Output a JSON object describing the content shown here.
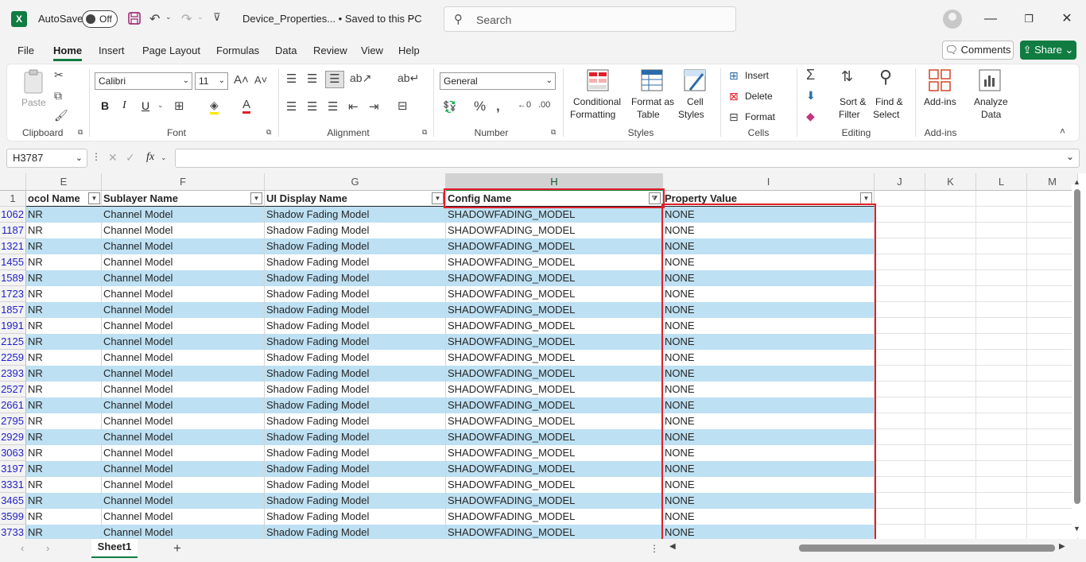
{
  "titlebar": {
    "autosave_label": "AutoSave",
    "autosave_state": "Off",
    "doc_title": "Device_Properties...  •  Saved to this PC",
    "search_placeholder": "Search"
  },
  "menu": {
    "items": [
      "File",
      "Home",
      "Insert",
      "Page Layout",
      "Formulas",
      "Data",
      "Review",
      "View",
      "Help"
    ],
    "active": "Home",
    "comments_label": "Comments",
    "share_label": "Share"
  },
  "ribbon": {
    "clipboard": {
      "label": "Clipboard",
      "paste": "Paste"
    },
    "font": {
      "label": "Font",
      "name": "Calibri",
      "size": "11"
    },
    "alignment": {
      "label": "Alignment"
    },
    "number": {
      "label": "Number",
      "format": "General"
    },
    "styles": {
      "label": "Styles",
      "conditional_1": "Conditional",
      "conditional_2": "Formatting",
      "format_table_1": "Format as",
      "format_table_2": "Table",
      "cell_styles_1": "Cell",
      "cell_styles_2": "Styles"
    },
    "cells": {
      "label": "Cells",
      "insert": "Insert",
      "delete": "Delete",
      "format": "Format"
    },
    "editing": {
      "label": "Editing",
      "sort_1": "Sort &",
      "sort_2": "Filter",
      "find_1": "Find &",
      "find_2": "Select"
    },
    "addins": {
      "label": "Add-ins",
      "addins": "Add-ins",
      "analyze_1": "Analyze",
      "analyze_2": "Data"
    }
  },
  "formula_bar": {
    "name_box": "H3787",
    "fx": "fx",
    "content": ""
  },
  "grid": {
    "columns": [
      "E",
      "F",
      "G",
      "H",
      "I",
      "J",
      "K",
      "L",
      "M"
    ],
    "selected_column": "H",
    "header_row_number": "1",
    "headers": {
      "E": "ocol Name",
      "F": "Sublayer Name",
      "G": "UI Display Name",
      "H": "Config Name",
      "I": "Property Value"
    },
    "row_numbers": [
      "1062",
      "1187",
      "1321",
      "1455",
      "1589",
      "1723",
      "1857",
      "1991",
      "2125",
      "2259",
      "2393",
      "2527",
      "2661",
      "2795",
      "2929",
      "3063",
      "3197",
      "3331",
      "3465",
      "3599",
      "3733"
    ],
    "row_values": {
      "E": "NR",
      "F": "Channel Model",
      "G": "Shadow Fading Model",
      "H": "SHADOWFADING_MODEL",
      "I": "NONE"
    }
  },
  "sheets": {
    "active": "Sheet1"
  }
}
